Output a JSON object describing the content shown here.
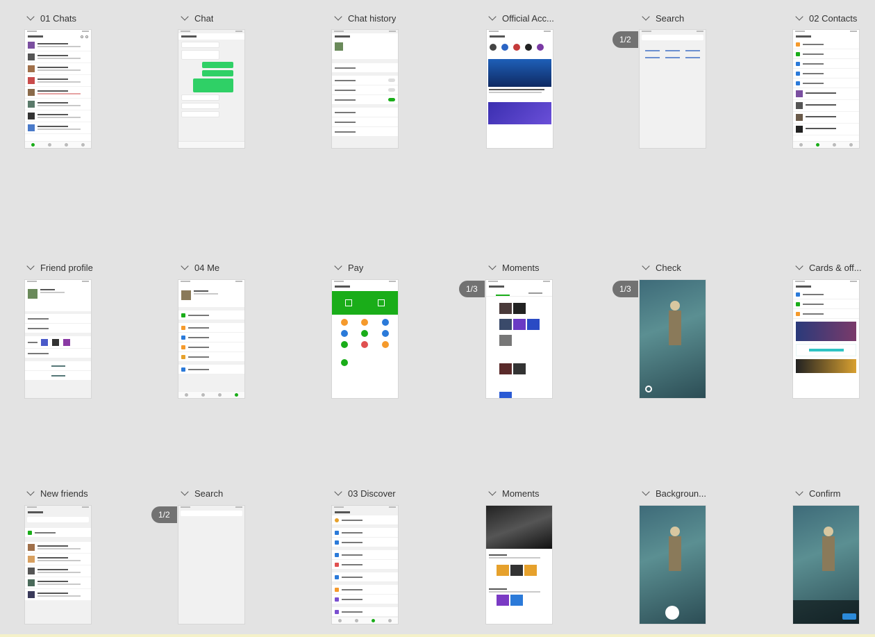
{
  "boards": [
    {
      "id": "chats",
      "title": "01 Chats"
    },
    {
      "id": "chat",
      "title": "Chat"
    },
    {
      "id": "chat-history",
      "title": "Chat history"
    },
    {
      "id": "official-acc",
      "title": "Official Acc..."
    },
    {
      "id": "search-1",
      "title": "Search"
    },
    {
      "id": "contacts",
      "title": "02 Contacts"
    },
    {
      "id": "friend-profile",
      "title": "Friend profile"
    },
    {
      "id": "me",
      "title": "04 Me"
    },
    {
      "id": "pay",
      "title": "Pay"
    },
    {
      "id": "moments-1",
      "title": "Moments"
    },
    {
      "id": "check",
      "title": "Check"
    },
    {
      "id": "cards",
      "title": "Cards & off..."
    },
    {
      "id": "new-friends",
      "title": "New friends"
    },
    {
      "id": "search-2",
      "title": "Search"
    },
    {
      "id": "discover",
      "title": "03 Discover"
    },
    {
      "id": "moments-2",
      "title": "Moments"
    },
    {
      "id": "background",
      "title": "Backgroun..."
    },
    {
      "id": "confirm",
      "title": "Confirm"
    }
  ],
  "pagers": {
    "search_1": "1/2",
    "moments_1": "1/3",
    "check": "1/3",
    "search_2": "1/2"
  },
  "colors": {
    "canvas": "#e3e3e3",
    "wechat_green": "#1aad19",
    "bubble_green": "#2fd066"
  }
}
